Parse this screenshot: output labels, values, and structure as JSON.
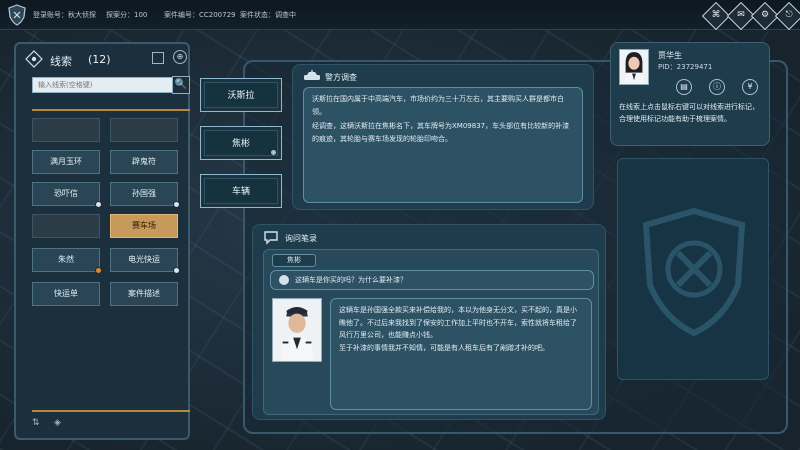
{
  "topbar": {
    "login_label": "登录账号：",
    "login_value": "秋大侦探",
    "score_label": "探案分：",
    "score_value": "100",
    "case_no_label": "案件编号：",
    "case_no_value": "CC200729",
    "case_status_label": "案件状态：",
    "case_status_value": "调查中"
  },
  "clues": {
    "title": "线索",
    "count": "(12)",
    "search_placeholder": "输入线索(空格键)",
    "items": [
      {
        "label": ""
      },
      {
        "label": ""
      },
      {
        "label": "满月玉环"
      },
      {
        "label": "辟鬼符"
      },
      {
        "label": "恐吓信"
      },
      {
        "label": "孙国强"
      },
      {
        "label": ""
      },
      {
        "label": "赛车场"
      },
      {
        "label": "朱然"
      },
      {
        "label": "电光快运"
      },
      {
        "label": "快运单"
      },
      {
        "label": "案件描述"
      }
    ]
  },
  "tabs": {
    "t1": "沃斯拉",
    "t2": "焦彬",
    "t3": "车辆"
  },
  "police": {
    "title": "警方调查",
    "p1": "沃斯拉在国内属于中高端汽车，市场价约为三十万左右，其主要购买人群是都市白领。",
    "p2": "经调查，这辆沃斯拉在焦彬名下，其车牌号为XM09837，车头部位有比较新的补漆的痕迹，其轮胎与赛车场发现的轮胎印吻合。"
  },
  "interrogation": {
    "title": "询问笔录",
    "tab": "焦彬",
    "question": "这辆车是你买的吗？为什么要补漆？",
    "a1": "这辆车是孙国强全款买来补偿给我的，本以为他身无分文，买不起的，真是小瞧他了。不过后来我找到了保安的工作加上平时也不开车，索性就将车租给了风行万里公司，也能赚点小钱。",
    "a2": "至于补漆的事情我并不知情，可能是有人租车后有了剐蹭才补的吧。"
  },
  "profile": {
    "name": "贾华生",
    "pid": "PID：23729471",
    "hint": "在线索上点击鼠标右键可以对线索进行标记，合理使用标记功能有助于梳理案情。"
  },
  "colors": {
    "accent_gold": "#c69a5a",
    "panel": "#1f3c4d",
    "text_box": "#2d5264"
  }
}
